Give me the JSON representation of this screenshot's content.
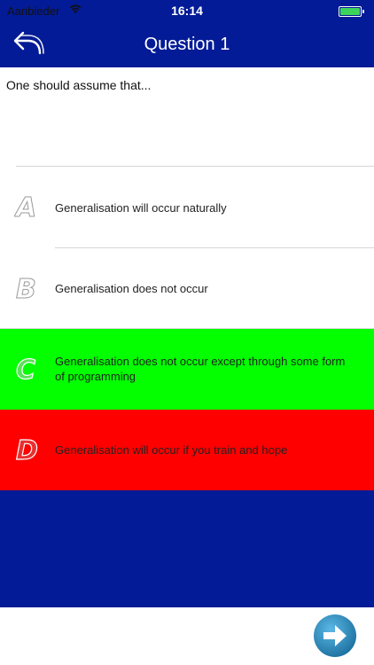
{
  "status_bar": {
    "carrier": "Aanbieder",
    "time": "16:14",
    "battery_color": "#3cd45a"
  },
  "nav": {
    "title": "Question 1",
    "back_icon": "back-arrow-icon",
    "color": "#031b96"
  },
  "question": {
    "text": "One should assume that..."
  },
  "answers": [
    {
      "letter": "A",
      "text": "Generalisation will occur naturally",
      "bg": "#ffffff"
    },
    {
      "letter": "B",
      "text": "Generalisation does not occur",
      "bg": "#ffffff"
    },
    {
      "letter": "C",
      "text": "Generalisation does not occur except through some form of programming",
      "bg": "#03ff00"
    },
    {
      "letter": "D",
      "text": "Generalisation will occur if you train and hope",
      "bg": "#ff0000"
    }
  ],
  "footer": {
    "next_icon": "next-arrow-icon"
  }
}
